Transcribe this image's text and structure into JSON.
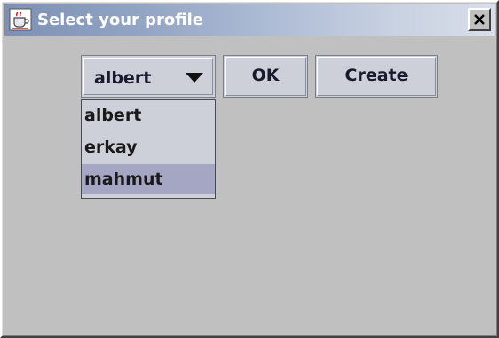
{
  "window": {
    "title": "Select your profile",
    "app_icon": "java-cup-icon",
    "close_icon": "close-icon"
  },
  "profile_combo": {
    "selected_value": "albert",
    "arrow_icon": "triangle-down-icon"
  },
  "buttons": {
    "ok_label": "OK",
    "create_label": "Create"
  },
  "dropdown": {
    "items": [
      {
        "label": "albert"
      },
      {
        "label": "erkay"
      },
      {
        "label": "mahmut",
        "highlighted": true
      }
    ]
  },
  "colors": {
    "window_bg": "#c0c0c0",
    "control_bg": "#cdd0d8",
    "highlight_bg": "#a4a6c4",
    "title_gradient_start": "#7d90b4",
    "title_gradient_end": "#d8deea"
  }
}
